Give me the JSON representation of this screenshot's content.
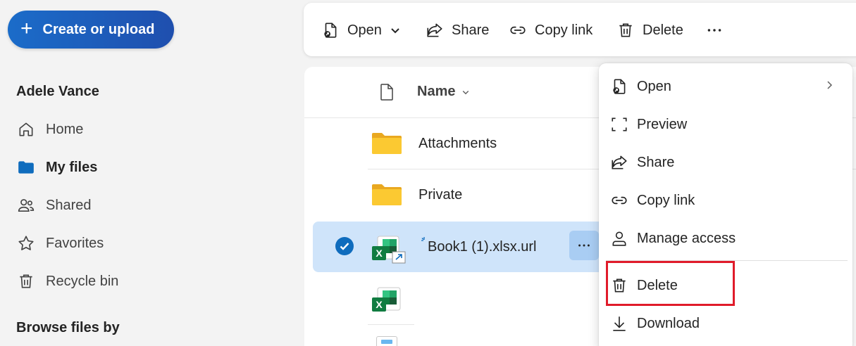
{
  "sidebar": {
    "create_label": "Create or upload",
    "user_name": "Adele Vance",
    "nav": [
      {
        "label": "Home",
        "icon": "home-icon"
      },
      {
        "label": "My files",
        "icon": "folder-icon",
        "active": true
      },
      {
        "label": "Shared",
        "icon": "people-icon"
      },
      {
        "label": "Favorites",
        "icon": "star-icon"
      },
      {
        "label": "Recycle bin",
        "icon": "trash-icon"
      }
    ],
    "browse_label": "Browse files by"
  },
  "toolbar": {
    "open_label": "Open",
    "share_label": "Share",
    "copy_link_label": "Copy link",
    "delete_label": "Delete"
  },
  "list": {
    "header_name": "Name",
    "rows": [
      {
        "name": "Attachments",
        "type": "folder"
      },
      {
        "name": "Private",
        "type": "folder"
      },
      {
        "name": "Book1 (1).xlsx.url",
        "type": "excel-link",
        "selected": true
      },
      {
        "name": "",
        "type": "excel"
      }
    ]
  },
  "context_menu": {
    "items": [
      {
        "label": "Open",
        "icon": "open-icon",
        "has_submenu": true
      },
      {
        "label": "Preview",
        "icon": "preview-icon"
      },
      {
        "label": "Share",
        "icon": "share-icon"
      },
      {
        "label": "Copy link",
        "icon": "link-icon"
      },
      {
        "label": "Manage access",
        "icon": "person-icon"
      },
      {
        "label": "Delete",
        "icon": "trash-icon",
        "highlighted": true
      },
      {
        "label": "Download",
        "icon": "download-icon"
      }
    ]
  },
  "colors": {
    "accent": "#0f6cbd",
    "selected_row": "#cfe4fa",
    "highlight_border": "#e01b2a",
    "folder_yellow": "#f5c02b"
  }
}
